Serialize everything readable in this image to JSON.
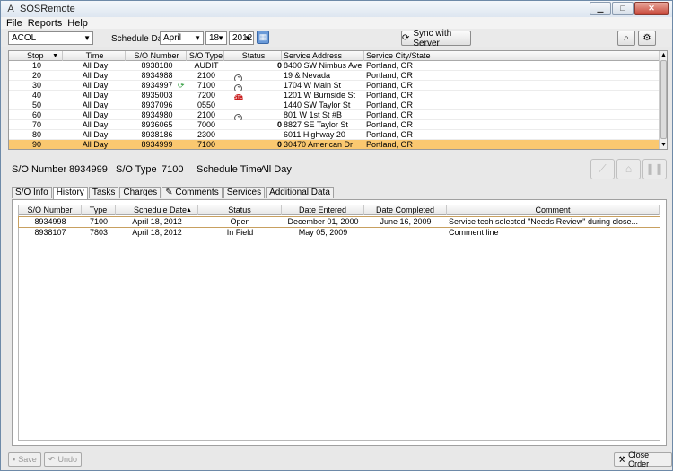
{
  "window": {
    "title": "SOSRemote",
    "app_icon": "A"
  },
  "menu": [
    "File",
    "Reports",
    "Help"
  ],
  "toolbar": {
    "route": "ACOL",
    "schedule_date_label": "Schedule Date",
    "month": "April",
    "day": "18",
    "year": "2012",
    "sync_label": "Sync with Server"
  },
  "stops": {
    "headers": [
      "Stop",
      "Time",
      "S/O Number",
      "S/O Type",
      "Status",
      "Service Address",
      "Service City/State"
    ],
    "rows": [
      {
        "stop": "10",
        "time": "All Day",
        "so_number": "8938180",
        "so_type": "AUDIT",
        "icon": "",
        "flag": "paperclip",
        "address": "8400 SW Nimbus Ave",
        "city": "Portland, OR",
        "selected": false
      },
      {
        "stop": "20",
        "time": "All Day",
        "so_number": "8934988",
        "so_type": "2100",
        "icon": "clock",
        "flag": "",
        "address": "19 & Nevada",
        "city": "Portland, OR",
        "selected": false
      },
      {
        "stop": "30",
        "time": "All Day",
        "so_number": "8934997",
        "so_type": "7100",
        "icon": "clock",
        "flag": "",
        "address": "1704 W Main St",
        "city": "Portland, OR",
        "selected": false,
        "refresh": true
      },
      {
        "stop": "40",
        "time": "All Day",
        "so_number": "8935003",
        "so_type": "7200",
        "icon": "stop",
        "flag": "",
        "address": "1201 W Burnside St",
        "city": "Portland, OR",
        "selected": false
      },
      {
        "stop": "50",
        "time": "All Day",
        "so_number": "8937096",
        "so_type": "0550",
        "icon": "",
        "flag": "",
        "address": "1440 SW Taylor St",
        "city": "Portland, OR",
        "selected": false
      },
      {
        "stop": "60",
        "time": "All Day",
        "so_number": "8934980",
        "so_type": "2100",
        "icon": "clock",
        "flag": "",
        "address": "801 W 1st St #B",
        "city": "Portland, OR",
        "selected": false
      },
      {
        "stop": "70",
        "time": "All Day",
        "so_number": "8936065",
        "so_type": "7000",
        "icon": "",
        "flag": "paperclip",
        "address": "8827 SE Taylor St",
        "city": "Portland, OR",
        "selected": false
      },
      {
        "stop": "80",
        "time": "All Day",
        "so_number": "8938186",
        "so_type": "2300",
        "icon": "",
        "flag": "",
        "address": "6011 Highway 20",
        "city": "Portland, OR",
        "selected": false
      },
      {
        "stop": "90",
        "time": "All Day",
        "so_number": "8934999",
        "so_type": "7100",
        "icon": "",
        "flag": "paperclip",
        "address": "30470 American Dr",
        "city": "Portland, OR",
        "selected": true
      }
    ]
  },
  "detail": {
    "so_number_label": "S/O Number",
    "so_number": "8934999",
    "so_type_label": "S/O Type",
    "so_type": "7100",
    "schedule_time_label": "Schedule Time",
    "schedule_time": "All Day"
  },
  "tabs": [
    "S/O Info",
    "History",
    "Tasks",
    "Charges",
    "Comments",
    "Services",
    "Additional Data"
  ],
  "active_tab": "History",
  "history": {
    "headers": [
      "S/O Number",
      "Type",
      "Schedule Date",
      "Status",
      "Date Entered",
      "Date Completed",
      "Comment"
    ],
    "rows": [
      {
        "so_number": "8934998",
        "type": "7100",
        "schedule_date": "April 18, 2012",
        "status": "Open",
        "date_entered": "December 01, 2000",
        "date_completed": "June 16, 2009",
        "comment": "Service tech selected \"Needs Review\" during close..."
      },
      {
        "so_number": "8938107",
        "type": "7803",
        "schedule_date": "April 18, 2012",
        "status": "In Field",
        "date_entered": "May 05, 2009",
        "date_completed": "",
        "comment": "Comment line"
      }
    ]
  },
  "bottom": {
    "save": "Save",
    "undo": "Undo",
    "close_order": "Close Order"
  }
}
